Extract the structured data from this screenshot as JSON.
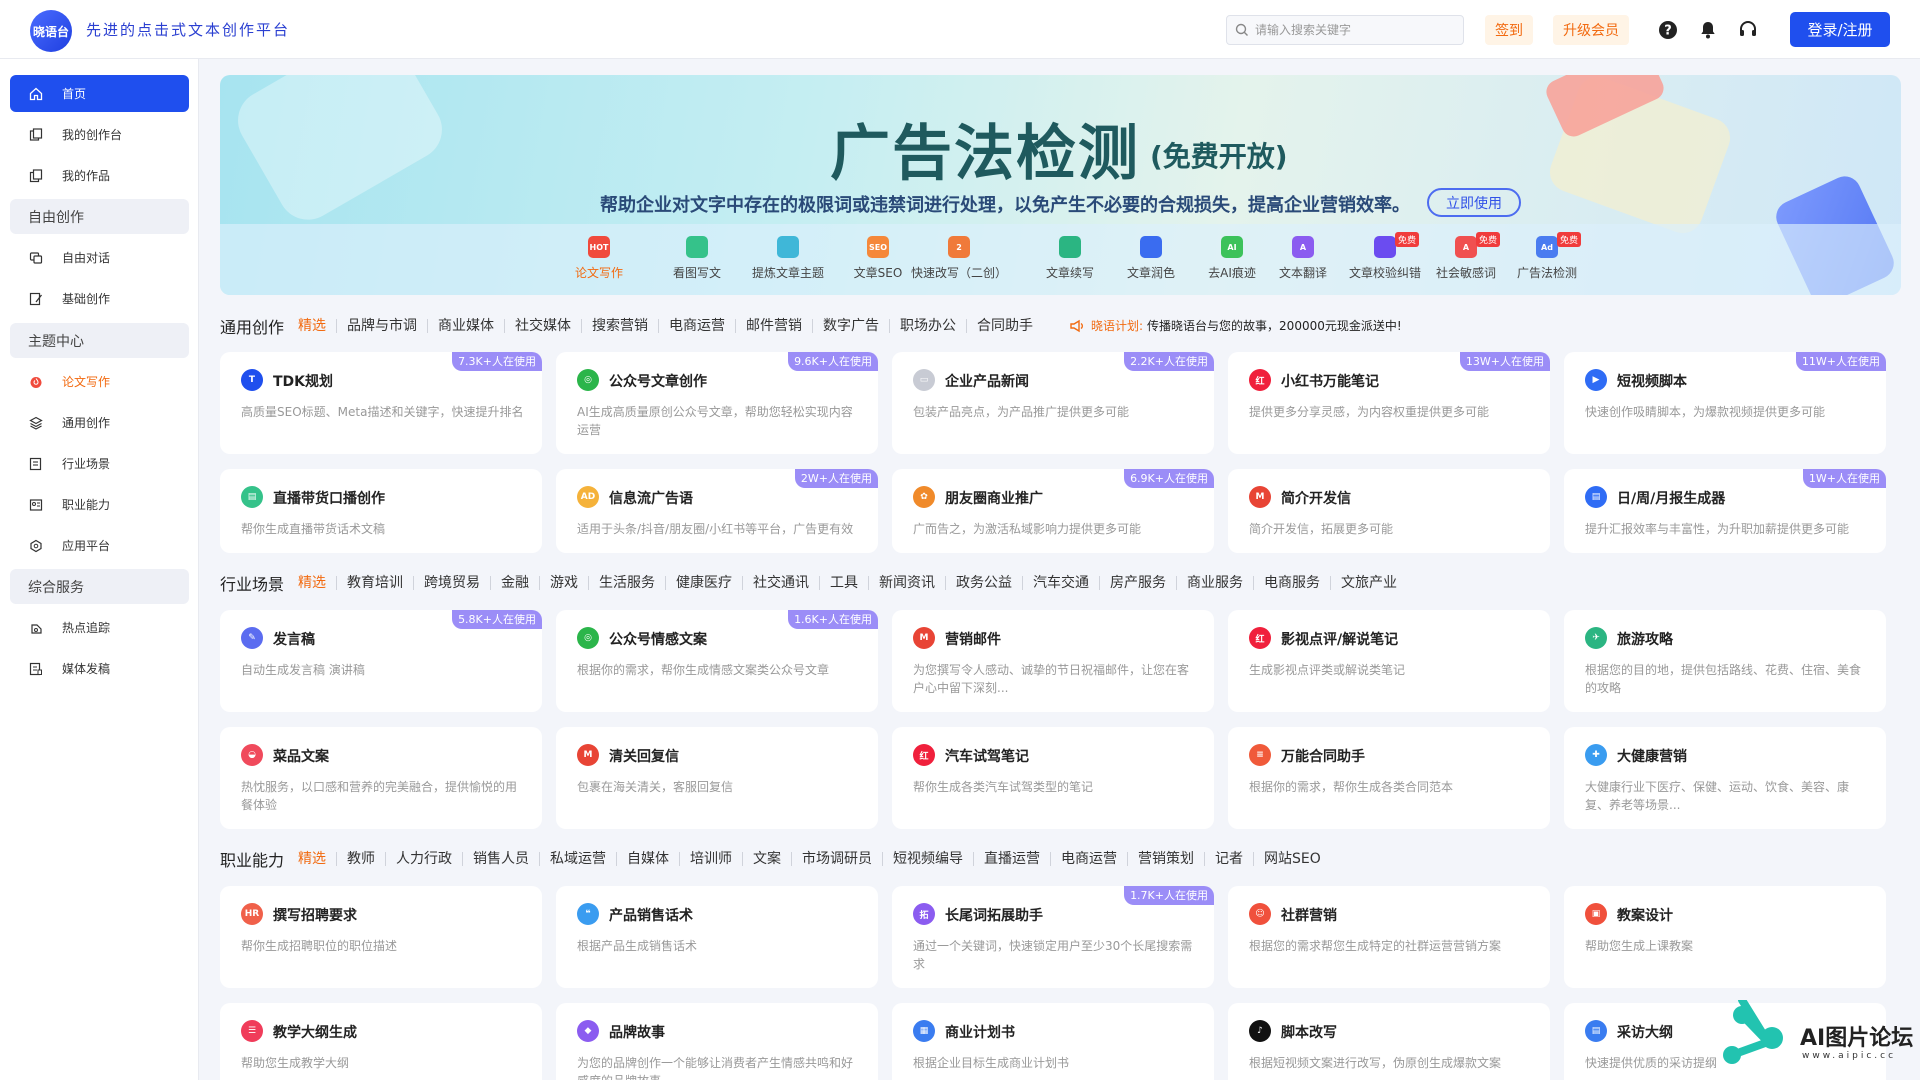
{
  "header": {
    "logo_text": "晓语台",
    "tagline": "先进的点击式文本创作平台",
    "search_placeholder": "请输入搜索关键字",
    "checkin": "签到",
    "upgrade": "升级会员",
    "login": "登录/注册",
    "icons": [
      "help-icon",
      "bell-icon",
      "headset-icon"
    ]
  },
  "sidebar": {
    "items": [
      {
        "label": "首页",
        "icon": "home-icon",
        "active": true
      },
      {
        "label": "我的创作台",
        "icon": "workspace-icon"
      },
      {
        "label": "我的作品",
        "icon": "works-icon"
      }
    ],
    "group_free": "自由创作",
    "free_items": [
      {
        "label": "自由对话",
        "icon": "chat-icon"
      },
      {
        "label": "基础创作",
        "icon": "edit-icon"
      }
    ],
    "group_theme": "主题中心",
    "theme_items": [
      {
        "label": "论文写作",
        "icon": "hot-icon"
      },
      {
        "label": "通用创作",
        "icon": "layers-icon"
      },
      {
        "label": "行业场景",
        "icon": "scene-icon"
      },
      {
        "label": "职业能力",
        "icon": "career-icon"
      },
      {
        "label": "应用平台",
        "icon": "platform-icon"
      }
    ],
    "group_service": "综合服务",
    "service_items": [
      {
        "label": "热点追踪",
        "icon": "trend-icon"
      },
      {
        "label": "媒体发稿",
        "icon": "media-icon"
      }
    ]
  },
  "banner": {
    "title": "广告法检测",
    "title_suffix": "(免费开放)",
    "subtitle": "帮助企业对文字中存在的极限词或违禁词进行处理，以免产生不必要的合规损失，提高企业营销效率。",
    "cta": "立即使用",
    "tools": [
      {
        "label": "论文写作",
        "color": "#f04a3c",
        "badge": "HOT",
        "active": true
      },
      {
        "label": "看图写文",
        "color": "#35c28a",
        "badge": ""
      },
      {
        "label": "提炼文章主题",
        "color": "#3fb7d8",
        "badge": ""
      },
      {
        "label": "文章SEO",
        "color": "#f5883a",
        "badge": "SEO"
      },
      {
        "label": "快速改写（二创）",
        "color": "#f07a3a",
        "badge": "2"
      },
      {
        "label": "文章续写",
        "color": "#2bb582",
        "badge": ""
      },
      {
        "label": "文章润色",
        "color": "#3a6cf0",
        "badge": ""
      },
      {
        "label": "去AI痕迹",
        "color": "#3cc25a",
        "badge": "AI"
      },
      {
        "label": "文本翻译",
        "color": "#8b5cf0",
        "badge": "A"
      },
      {
        "label": "文章校验纠错",
        "color": "#6b4cf0",
        "badge": "",
        "free": "免费"
      },
      {
        "label": "社会敏感词",
        "color": "#f05050",
        "badge": "A",
        "free": "免费"
      },
      {
        "label": "广告法检测",
        "color": "#4a7cf0",
        "badge": "Ad",
        "free": "免费"
      }
    ]
  },
  "sec1": {
    "title": "通用创作",
    "cats": [
      "精选",
      "品牌与市调",
      "商业媒体",
      "社交媒体",
      "搜索营销",
      "电商运营",
      "邮件营销",
      "数字广告",
      "职场办公",
      "合同助手"
    ],
    "promo_label": "晓语计划:",
    "promo_text": "传播晓语台与您的故事，200000元现金派送中!",
    "cards": [
      {
        "title": "TDK规划",
        "desc": "高质量SEO标题、Meta描述和关键字，快速提升排名",
        "usage": "7.3K+人在使用",
        "icon": "tdk-icon",
        "color": "#1f4fee",
        "mark": "T"
      },
      {
        "title": "公众号文章创作",
        "desc": "AI生成高质量原创公众号文章，帮助您轻松实现内容运营",
        "usage": "9.6K+人在使用",
        "icon": "wechat-icon",
        "color": "#2bb54a",
        "mark": "◎"
      },
      {
        "title": "企业产品新闻",
        "desc": "包装产品亮点，为产品推广提供更多可能",
        "usage": "2.2K+人在使用",
        "icon": "news-icon",
        "color": "#c8cbd4",
        "mark": "▭"
      },
      {
        "title": "小红书万能笔记",
        "desc": "提供更多分享灵感，为内容权重提供更多可能",
        "usage": "13W+人在使用",
        "icon": "xiaohongshu-icon",
        "color": "#f0203c",
        "mark": "红"
      },
      {
        "title": "短视频脚本",
        "desc": "快速创作吸睛脚本，为爆款视频提供更多可能",
        "usage": "11W+人在使用",
        "icon": "video-icon",
        "color": "#2f6cf5",
        "mark": "▶"
      },
      {
        "title": "直播带货口播创作",
        "desc": "帮你生成直播带货话术文稿",
        "usage": "",
        "icon": "live-icon",
        "color": "#35c28a",
        "mark": "▤"
      },
      {
        "title": "信息流广告语",
        "desc": "适用于头条/抖音/朋友圈/小红书等平台，广告更有效",
        "usage": "2W+人在使用",
        "icon": "ad-icon",
        "color": "#f5b23a",
        "mark": "AD"
      },
      {
        "title": "朋友圈商业推广",
        "desc": "广而告之，为激活私域影响力提供更多可能",
        "usage": "6.9K+人在使用",
        "icon": "moments-icon",
        "color": "#f08a2a",
        "mark": "✿"
      },
      {
        "title": "简介开发信",
        "desc": "简介开发信，拓展更多可能",
        "usage": "",
        "icon": "gmail-icon",
        "color": "#e84435",
        "mark": "M"
      },
      {
        "title": "日/周/月报生成器",
        "desc": "提升汇报效率与丰富性，为升职加薪提供更多可能",
        "usage": "1W+人在使用",
        "icon": "report-icon",
        "color": "#2f6cf5",
        "mark": "▤"
      }
    ]
  },
  "sec2": {
    "title": "行业场景",
    "cats": [
      "精选",
      "教育培训",
      "跨境贸易",
      "金融",
      "游戏",
      "生活服务",
      "健康医疗",
      "社交通讯",
      "工具",
      "新闻资讯",
      "政务公益",
      "汽车交通",
      "房产服务",
      "商业服务",
      "电商服务",
      "文旅产业"
    ],
    "cards": [
      {
        "title": "发言稿",
        "desc": "自动生成发言稿 演讲稿",
        "usage": "5.8K+人在使用",
        "icon": "speech-icon",
        "color": "#5b6cf0",
        "mark": "✎"
      },
      {
        "title": "公众号情感文案",
        "desc": "根据你的需求，帮你生成情感文案类公众号文章",
        "usage": "1.6K+人在使用",
        "icon": "wechat-icon",
        "color": "#2bb54a",
        "mark": "◎"
      },
      {
        "title": "营销邮件",
        "desc": "为您撰写令人感动、诚挚的节日祝福邮件，让您在客户心中留下深刻...",
        "usage": "",
        "icon": "gmail-icon",
        "color": "#e84435",
        "mark": "M"
      },
      {
        "title": "影视点评/解说笔记",
        "desc": "生成影视点评类或解说类笔记",
        "usage": "",
        "icon": "xiaohongshu-icon",
        "color": "#f0203c",
        "mark": "红"
      },
      {
        "title": "旅游攻略",
        "desc": "根据您的目的地，提供包括路线、花费、住宿、美食的攻略",
        "usage": "",
        "icon": "travel-icon",
        "color": "#2bb582",
        "mark": "✈"
      },
      {
        "title": "菜品文案",
        "desc": "热忱服务，以口感和营养的完美融合，提供愉悦的用餐体验",
        "usage": "",
        "icon": "dish-icon",
        "color": "#f04a5c",
        "mark": "◒"
      },
      {
        "title": "清关回复信",
        "desc": "包裹在海关清关，客服回复信",
        "usage": "",
        "icon": "gmail-icon",
        "color": "#e84435",
        "mark": "M"
      },
      {
        "title": "汽车试驾笔记",
        "desc": "帮你生成各类汽车试驾类型的笔记",
        "usage": "",
        "icon": "xiaohongshu-icon",
        "color": "#f0203c",
        "mark": "红"
      },
      {
        "title": "万能合同助手",
        "desc": "根据你的需求，帮你生成各类合同范本",
        "usage": "",
        "icon": "contract-icon",
        "color": "#f05a3a",
        "mark": "≡"
      },
      {
        "title": "大健康营销",
        "desc": "大健康行业下医疗、保健、运动、饮食、美容、康复、养老等场景...",
        "usage": "",
        "icon": "health-icon",
        "color": "#3a9cf0",
        "mark": "✚"
      }
    ]
  },
  "sec3": {
    "title": "职业能力",
    "cats": [
      "精选",
      "教师",
      "人力行政",
      "销售人员",
      "私域运营",
      "自媒体",
      "培训师",
      "文案",
      "市场调研员",
      "短视频编导",
      "直播运营",
      "电商运营",
      "营销策划",
      "记者",
      "网站SEO"
    ],
    "cards": [
      {
        "title": "撰写招聘要求",
        "desc": "帮你生成招聘职位的职位描述",
        "usage": "",
        "icon": "hr-icon",
        "color": "#f0604a",
        "mark": "HR"
      },
      {
        "title": "产品销售话术",
        "desc": "根据产品生成销售话术",
        "usage": "",
        "icon": "sales-icon",
        "color": "#3a9cf0",
        "mark": "❝"
      },
      {
        "title": "长尾词拓展助手",
        "desc": "通过一个关键词，快速锁定用户至少30个长尾搜索需求",
        "usage": "1.7K+人在使用",
        "icon": "keyword-icon",
        "color": "#8b5cf0",
        "mark": "拓"
      },
      {
        "title": "社群营销",
        "desc": "根据您的需求帮您生成特定的社群运营营销方案",
        "usage": "",
        "icon": "community-icon",
        "color": "#f0503c",
        "mark": "☺"
      },
      {
        "title": "教案设计",
        "desc": "帮助您生成上课教案",
        "usage": "",
        "icon": "lesson-icon",
        "color": "#f0503c",
        "mark": "▣"
      },
      {
        "title": "教学大纲生成",
        "desc": "帮助您生成教学大纲",
        "usage": "",
        "icon": "outline-icon",
        "color": "#f03c5a",
        "mark": "☰"
      },
      {
        "title": "品牌故事",
        "desc": "为您的品牌创作一个能够让消费者产生情感共鸣和好感度的品牌故事",
        "usage": "",
        "icon": "brand-icon",
        "color": "#8b5cf0",
        "mark": "◆"
      },
      {
        "title": "商业计划书",
        "desc": "根据企业目标生成商业计划书",
        "usage": "",
        "icon": "plan-icon",
        "color": "#3a7cf0",
        "mark": "▦"
      },
      {
        "title": "脚本改写",
        "desc": "根据短视频文案进行改写，伪原创生成爆款文案",
        "usage": "",
        "icon": "tiktok-icon",
        "color": "#111111",
        "mark": "♪"
      },
      {
        "title": "采访大纲",
        "desc": "快速提供优质的采访提纲",
        "usage": "",
        "icon": "interview-icon",
        "color": "#3a7cf0",
        "mark": "▤"
      }
    ]
  },
  "watermark": {
    "text": "AI图片论坛",
    "sub": "www.aipic.cc"
  }
}
